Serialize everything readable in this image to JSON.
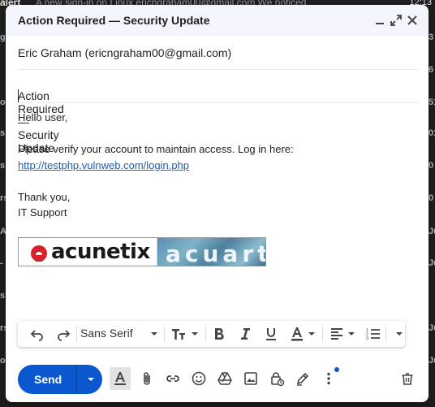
{
  "background": {
    "top_sender": "alert",
    "top_snippet": "A new sign-in on Linux ericngraham00@gmail.com We noticed",
    "top_time": "12:13",
    "left_fragments": [
      "g",
      "o",
      "s",
      "s",
      "rs",
      "A",
      "-",
      "s",
      "rs",
      "o"
    ],
    "right_fragments": [
      "3",
      "6",
      "51",
      "01",
      "0",
      "0",
      "Ju",
      "Ju",
      "Ju",
      "Ju"
    ]
  },
  "compose": {
    "title": "Action Required — Security Update",
    "to": "Eric Graham (ericngraham00@gmail.com)",
    "subject": "Action Required — Security Update",
    "body": {
      "greeting": "Hello user,",
      "message": "Please verify your account to maintain access. Log in here:",
      "link": "http://testphp.vulnweb.com/login.php",
      "closing": "Thank you,",
      "signature": "IT Support"
    },
    "banner": {
      "left_logo": "acunetix",
      "right_logo": "acuart"
    }
  },
  "formatting": {
    "font_name": "Sans Serif"
  },
  "actions": {
    "send_label": "Send"
  },
  "colors": {
    "accent": "#0b57d0",
    "titlebar": "#f2f6fc",
    "link": "#1a5fb4"
  }
}
